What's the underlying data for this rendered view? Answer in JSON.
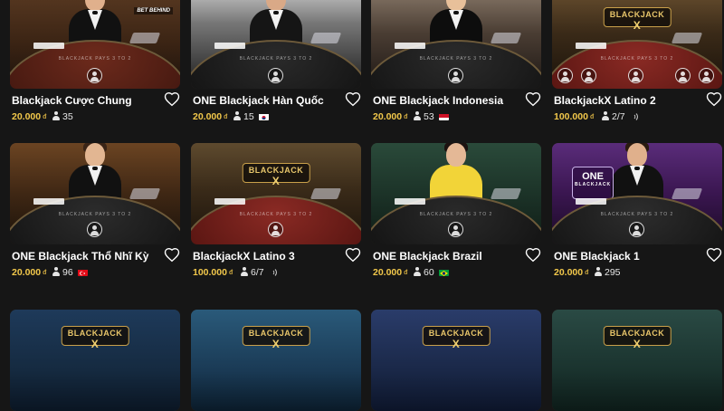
{
  "games": [
    {
      "title": "Blackjack Cược Chung",
      "bet": "20.000",
      "currency": "đ",
      "players": "35",
      "flag": "",
      "sound": false,
      "style": "classic",
      "badge": "BET BEHIND"
    },
    {
      "title": "ONE Blackjack Hàn Quốc",
      "bet": "20.000",
      "currency": "đ",
      "players": "15",
      "flag": "kr",
      "sound": false,
      "style": "dark"
    },
    {
      "title": "ONE Blackjack Indonesia",
      "bet": "20.000",
      "currency": "đ",
      "players": "53",
      "flag": "id",
      "sound": false,
      "style": "warm"
    },
    {
      "title": "BlackjackX Latino 2",
      "bet": "100.000",
      "currency": "đ",
      "players": "2/7",
      "flag": "",
      "sound": true,
      "style": "bjx-red"
    },
    {
      "title": "ONE Blackjack Thổ Nhĩ Kỳ",
      "bet": "20.000",
      "currency": "đ",
      "players": "96",
      "flag": "tr",
      "sound": false,
      "style": "classic-gold"
    },
    {
      "title": "BlackjackX Latino 3",
      "bet": "100.000",
      "currency": "đ",
      "players": "6/7",
      "flag": "",
      "sound": true,
      "style": "bjx-red2"
    },
    {
      "title": "ONE Blackjack Brazil",
      "bet": "20.000",
      "currency": "đ",
      "players": "60",
      "flag": "br",
      "sound": false,
      "style": "green"
    },
    {
      "title": "ONE Blackjack 1",
      "bet": "20.000",
      "currency": "đ",
      "players": "295",
      "flag": "",
      "sound": false,
      "style": "purple"
    },
    {
      "title": "",
      "style": "bjx-blue1"
    },
    {
      "title": "",
      "style": "bjx-blue2"
    },
    {
      "title": "",
      "style": "bjx-blue3"
    },
    {
      "title": "",
      "style": "bjx-teal"
    }
  ],
  "table_text": "BLACKJACK PAYS 3 TO 2",
  "logo_text": "BLACKJACK",
  "logo_x": "X",
  "one_logo_l1": "ONE",
  "one_logo_l2": "BLACKJACK",
  "badge_text": "BET BEHIND",
  "colors": {
    "background": "#161616",
    "bet_gold": "#f2c84b",
    "logo_gold": "#c9a04a"
  },
  "icons": {
    "favorite": "heart-outline-icon",
    "players": "user-icon",
    "seat": "seat-user-icon",
    "sound": "sound-icon"
  }
}
